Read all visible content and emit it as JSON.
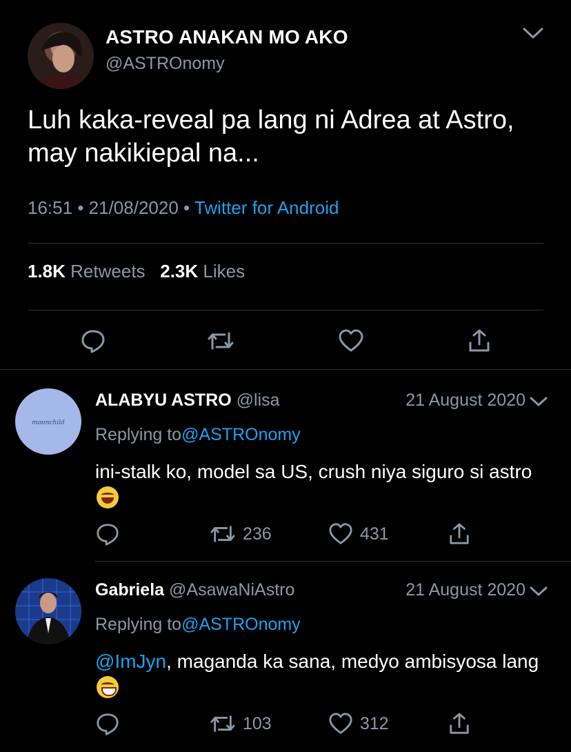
{
  "main_tweet": {
    "name": "ASTRO ANAKAN MO AKO",
    "handle": "@ASTROnomy",
    "text": "Luh kaka-reveal pa lang ni Adrea at Astro, may nakikiepal na...",
    "time": "16:51",
    "date": "21/08/2020",
    "source": "Twitter for Android",
    "separator": "•",
    "retweets_count": "1.8K",
    "retweets_label": "Retweets",
    "likes_count": "2.3K",
    "likes_label": "Likes"
  },
  "replies": [
    {
      "name": "ALABYU ASTRO",
      "handle": "@lisa",
      "date": "21 August 2020",
      "replying_label": "Replying to",
      "replying_handle": "@ASTROnomy",
      "text": "ini-stalk ko, model sa US, crush niya siguro si astro",
      "emoji": "grinning-squinting-face",
      "retweets": "236",
      "likes": "431",
      "avatar_text": "moonchild"
    },
    {
      "name": "Gabriela",
      "handle": "@AsawaNiAstro",
      "date": "21 August 2020",
      "replying_label": "Replying to",
      "replying_handle": "@ASTROnomy",
      "mention": "@ImJyn",
      "text": ", maganda ka sana, medyo ambisyosa lang",
      "emoji": "beaming-face",
      "retweets": "103",
      "likes": "312"
    }
  ],
  "colors": {
    "background": "#000000",
    "muted": "#8b98a5",
    "accent": "#1da1f2",
    "divider": "#2f3336"
  },
  "icons": [
    "chevron-down-icon",
    "reply-icon",
    "retweet-icon",
    "like-icon",
    "share-icon"
  ]
}
